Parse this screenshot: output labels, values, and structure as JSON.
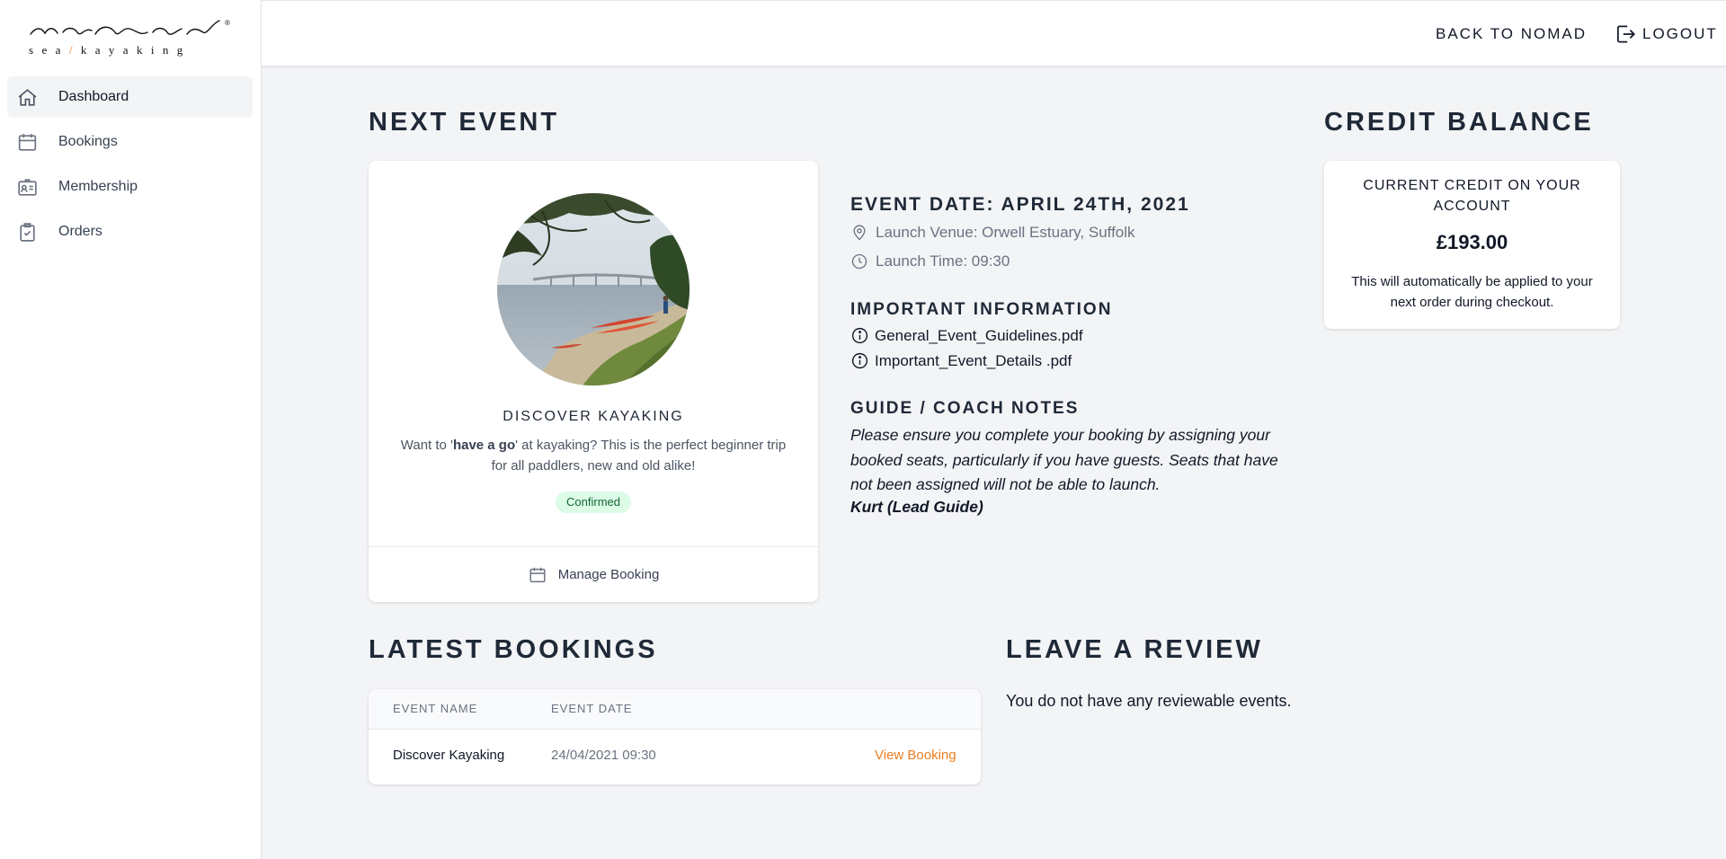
{
  "brand": {
    "logo_script": "nomad",
    "logo_sub_pre": "sea",
    "logo_sub_slash": "/",
    "logo_sub_post": "kayaking",
    "reg_mark": "®",
    "accent": "#f97316"
  },
  "sidebar": {
    "items": [
      {
        "label": "Dashboard",
        "icon": "home-icon",
        "active": true
      },
      {
        "label": "Bookings",
        "icon": "calendar-icon",
        "active": false
      },
      {
        "label": "Membership",
        "icon": "id-card-icon",
        "active": false
      },
      {
        "label": "Orders",
        "icon": "clipboard-check-icon",
        "active": false
      }
    ]
  },
  "topbar": {
    "back_label": "BACK TO NOMAD",
    "logout_label": "LOGOUT"
  },
  "next_event": {
    "heading": "NEXT EVENT",
    "title": "DISCOVER KAYAKING",
    "desc_pre": "Want to '",
    "desc_bold": "have a go",
    "desc_post": "' at kayaking? This is the perfect beginner trip for all paddlers, new and old alike!",
    "status": "Confirmed",
    "manage_label": "Manage Booking",
    "date_label": "EVENT DATE: APRIL 24TH, 2021",
    "venue": "Launch Venue: Orwell Estuary, Suffolk",
    "time": "Launch Time: 09:30",
    "info_heading": "IMPORTANT INFORMATION",
    "documents": [
      "General_Event_Guidelines.pdf",
      "Important_Event_Details .pdf"
    ],
    "notes_heading": "GUIDE / COACH NOTES",
    "notes": "Please ensure you complete your booking by assigning your booked seats, particularly if you have guests. Seats that have not been assigned will not be able to launch.",
    "notes_sign": "Kurt (Lead Guide)"
  },
  "credit": {
    "heading": "CREDIT BALANCE",
    "label": "CURRENT CREDIT ON YOUR ACCOUNT",
    "amount": "£193.00",
    "note": "This will automatically be applied to your next order during checkout."
  },
  "latest_bookings": {
    "heading": "LATEST BOOKINGS",
    "columns": [
      "EVENT NAME",
      "EVENT DATE"
    ],
    "rows": [
      {
        "name": "Discover Kayaking",
        "date": "24/04/2021 09:30",
        "action": "View Booking"
      }
    ]
  },
  "review": {
    "heading": "LEAVE A REVIEW",
    "empty_text": "You do not have any reviewable events."
  }
}
